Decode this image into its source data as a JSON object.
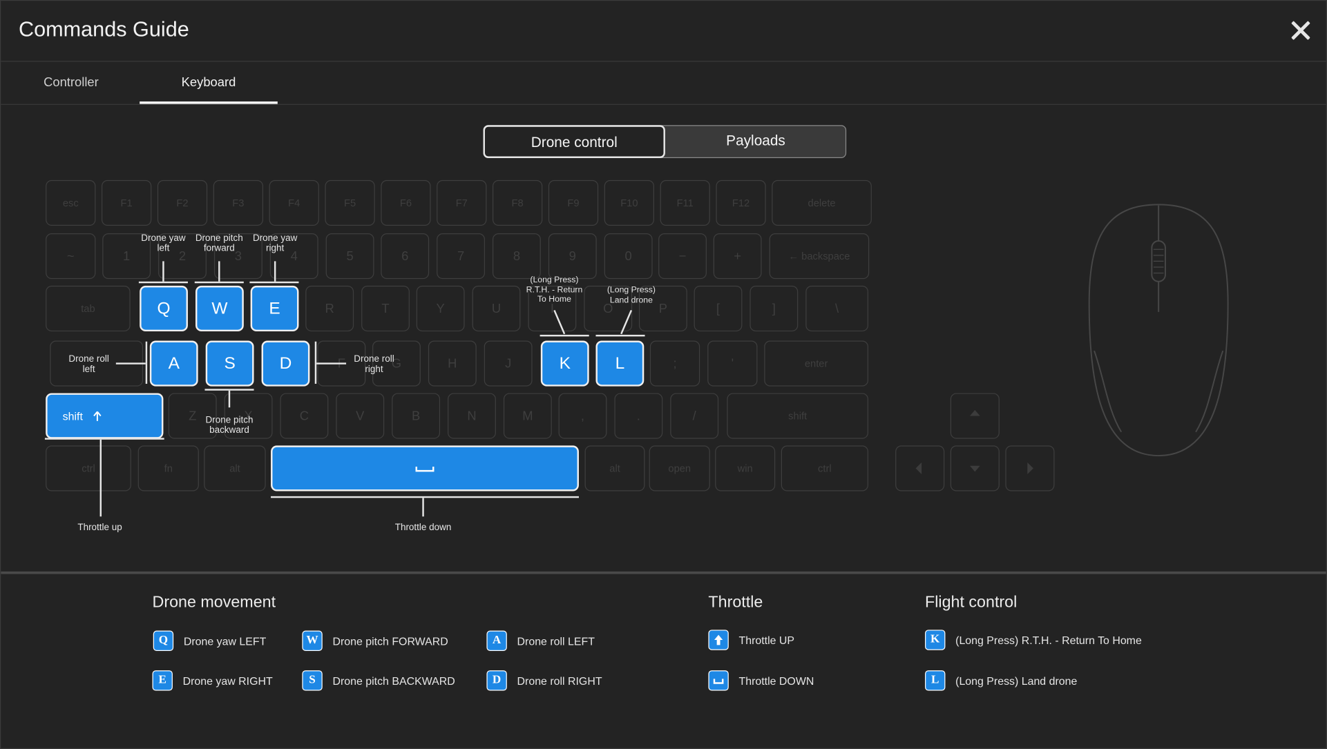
{
  "header": {
    "title": "Commands Guide"
  },
  "tabs": [
    {
      "label": "Controller",
      "active": false
    },
    {
      "label": "Keyboard",
      "active": true
    }
  ],
  "mode_toggle": {
    "selected": "Drone control",
    "options": [
      "Drone control",
      "Payloads"
    ]
  },
  "accent_color": "#1e88e5",
  "keyboard": {
    "function_row": [
      "esc",
      "F1",
      "F2",
      "F3",
      "F4",
      "F5",
      "F6",
      "F7",
      "F8",
      "F9",
      "F10",
      "F11",
      "F12",
      "delete"
    ],
    "number_row": [
      "~",
      "1",
      "2",
      "3",
      "4",
      "5",
      "6",
      "7",
      "8",
      "9",
      "0",
      "−",
      "+",
      "← backspace"
    ],
    "top_row": [
      "tab",
      "Q",
      "W",
      "E",
      "R",
      "T",
      "Y",
      "U",
      "I",
      "O",
      "P",
      "[",
      "]",
      "\\"
    ],
    "home_row": [
      "A",
      "S",
      "D",
      "F",
      "G",
      "H",
      "J",
      "K",
      "L",
      ";",
      "'",
      "enter"
    ],
    "bottom_row": [
      "shift",
      "Z",
      "X",
      "C",
      "V",
      "B",
      "N",
      "M",
      ",",
      ".",
      "/",
      "shift"
    ],
    "space_row": [
      "ctrl",
      "fn",
      "alt",
      "space",
      "alt",
      "open",
      "win",
      "ctrl"
    ],
    "arrow_keys": [
      "arrow-up",
      "arrow-left",
      "arrow-down",
      "arrow-right"
    ],
    "highlighted": {
      "Q": "Q",
      "W": "W",
      "E": "E",
      "A": "A",
      "S": "S",
      "D": "D",
      "K": "K",
      "L": "L",
      "shift": "shift",
      "space": "⎵"
    }
  },
  "annotations": {
    "q": "Drone yaw left",
    "w": "Drone pitch forward",
    "e": "Drone yaw right",
    "a": "Drone roll left",
    "s": "Drone pitch backward",
    "d": "Drone roll right",
    "k": "(Long Press) R.T.H. - Return To Home",
    "l": "(Long Press) Land drone",
    "shift": "Throttle up",
    "space": "Throttle down"
  },
  "legend": {
    "movement": {
      "title": "Drone movement",
      "items": [
        {
          "key": "Q",
          "text": "Drone yaw LEFT"
        },
        {
          "key": "W",
          "text": "Drone pitch FORWARD"
        },
        {
          "key": "A",
          "text": "Drone roll LEFT"
        },
        {
          "key": "E",
          "text": "Drone yaw RIGHT"
        },
        {
          "key": "S",
          "text": "Drone pitch BACKWARD"
        },
        {
          "key": "D",
          "text": "Drone roll RIGHT"
        }
      ]
    },
    "throttle": {
      "title": "Throttle",
      "items": [
        {
          "key": "arrow-up-icon",
          "text": "Throttle UP"
        },
        {
          "key": "space-icon",
          "text": "Throttle DOWN"
        }
      ]
    },
    "flight": {
      "title": "Flight control",
      "items": [
        {
          "key": "K",
          "text": "(Long Press) R.T.H. - Return To Home"
        },
        {
          "key": "L",
          "text": "(Long Press) Land drone"
        }
      ]
    }
  }
}
